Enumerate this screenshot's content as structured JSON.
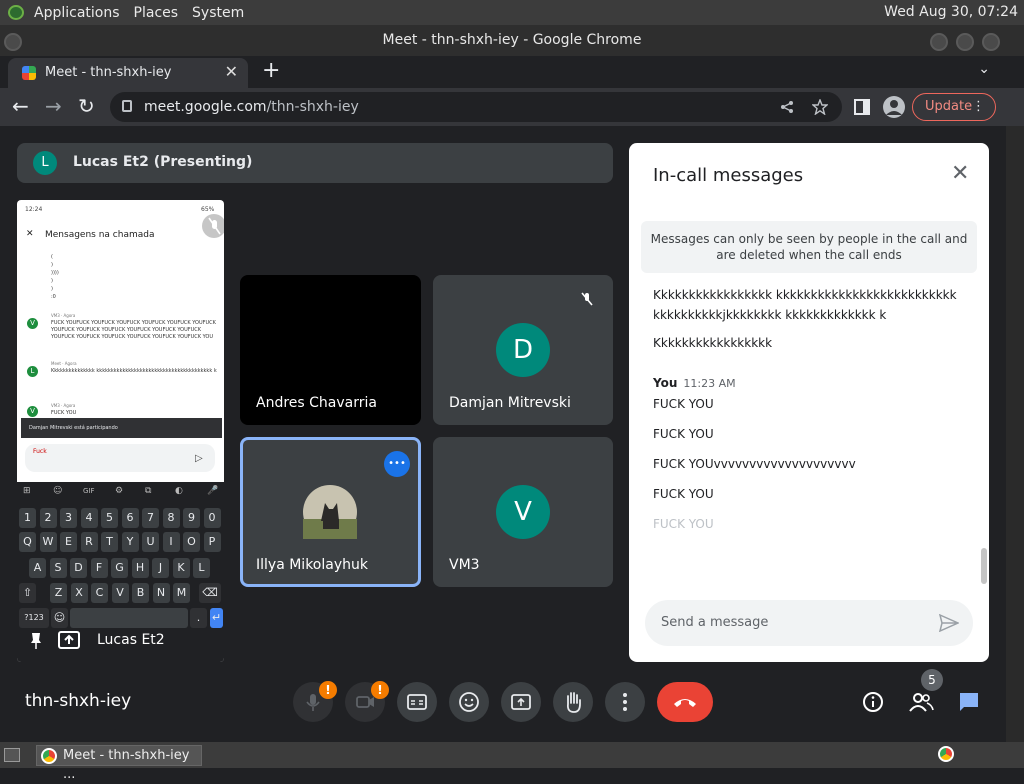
{
  "top_panel": {
    "menus": [
      "Applications",
      "Places",
      "System"
    ],
    "clock": "Wed Aug 30, 07:24"
  },
  "window": {
    "title": "Meet - thn-shxh-iey - Google Chrome"
  },
  "tab": {
    "label": "Meet - thn-shxh-iey",
    "close": "✕",
    "new_tab": "+",
    "tab_menu": "⌄"
  },
  "toolbar": {
    "url_host": "meet.google.com",
    "url_path": "/thn-shxh-iey",
    "update_label": "Update",
    "update_dots": "⋮",
    "back": "←",
    "forward": "→",
    "reload": "↻"
  },
  "presenting": {
    "initial": "L",
    "label": "Lucas Et2 (Presenting)"
  },
  "phone_share": {
    "status_time": "12:24",
    "status_battery": "65%",
    "header": "Mensagens na chamada",
    "close": "✕",
    "messages": [
      "(",
      ")",
      "))))",
      ")",
      ")",
      ":0"
    ],
    "msg_v_sender": "VM3  ·  Agora",
    "msg_v_text": "FUCK YOUFUCK YOUFUCK YOUFUCK YOUFUCK YOUFUCK YOUFUCK YOUFUCK YOUFUCK YOUFUCK YOUFUCK YOUFUCK YOUFUCK YOUFUCK YOUFUCK YOUFUCK YOUFUCK YOUFUCK YOUFUCK YOU",
    "msg_l_sender": "Meet  ·  Agora",
    "msg_l_text": "Kkkkkkkkkkkkkkk kkkkkkkkkkkkkkkkkkkkkkkkkkkkkkkkkkkkkkkk k",
    "msg_v2_sender": "VM3  ·  Agora",
    "msg_v2_text": "FUCK YOU",
    "toast": "Damjan Mitrevski está participando",
    "input_text": "Fuck",
    "send": "▷",
    "keyboard_top": [
      "⊞",
      "☺",
      "GIF",
      "⚙",
      "⧉",
      "◐",
      "🎤"
    ],
    "keys_row1": [
      "1",
      "2",
      "3",
      "4",
      "5",
      "6",
      "7",
      "8",
      "9",
      "0"
    ],
    "keys_row2": [
      "Q",
      "W",
      "E",
      "R",
      "T",
      "Y",
      "U",
      "I",
      "O",
      "P"
    ],
    "keys_row3": [
      "A",
      "S",
      "D",
      "F",
      "G",
      "H",
      "J",
      "K",
      "L"
    ],
    "keys_row4": [
      "⇧",
      "Z",
      "X",
      "C",
      "V",
      "B",
      "N",
      "M",
      "⌫"
    ],
    "key_sym": "?123",
    "key_emoji": "☺",
    "key_enter": "↵",
    "key_dot": ".",
    "name": "Lucas Et2"
  },
  "tiles": {
    "andres": {
      "name": "Andres Chavarria"
    },
    "damjan": {
      "name": "Damjan Mitrevski",
      "initial": "D"
    },
    "illya": {
      "name": "Illya Mikolayhuk",
      "more": "•••"
    },
    "vm3": {
      "name": "VM3",
      "initial": "V"
    }
  },
  "chat": {
    "title": "In-call messages",
    "close": "✕",
    "notice": "Messages can only be seen by people in the call and are deleted when the call ends",
    "messages": [
      "Kkkkkkkkkkkkkkkkk kkkkkkkkkkkkkkkkkkkkkkkkkkkkkkkkkkkkjkkkkkkkk kkkkkkkkkkkkk k",
      "Kkkkkkkkkkkkkkkkk"
    ],
    "sender": "You",
    "time": "11:23 AM",
    "my_messages": [
      "FUCK YOU",
      "FUCK YOU",
      "FUCK YOUvvvvvvvvvvvvvvvvvvvv",
      "FUCK YOU",
      "FUCK YOU"
    ],
    "placeholder": "Send a message"
  },
  "controls": {
    "meeting_code": "thn-shxh-iey",
    "warn": "!",
    "participants_count": "5"
  },
  "taskbar": {
    "task_label": "Meet - thn-shxh-iey ..."
  },
  "colors": {
    "meet_bg": "#202124",
    "tile_bg": "#3c4043",
    "teal_avatar": "#00897b",
    "end_call": "#ea4335",
    "highlight_border": "#8ab4f8",
    "warning": "#f57c00"
  }
}
